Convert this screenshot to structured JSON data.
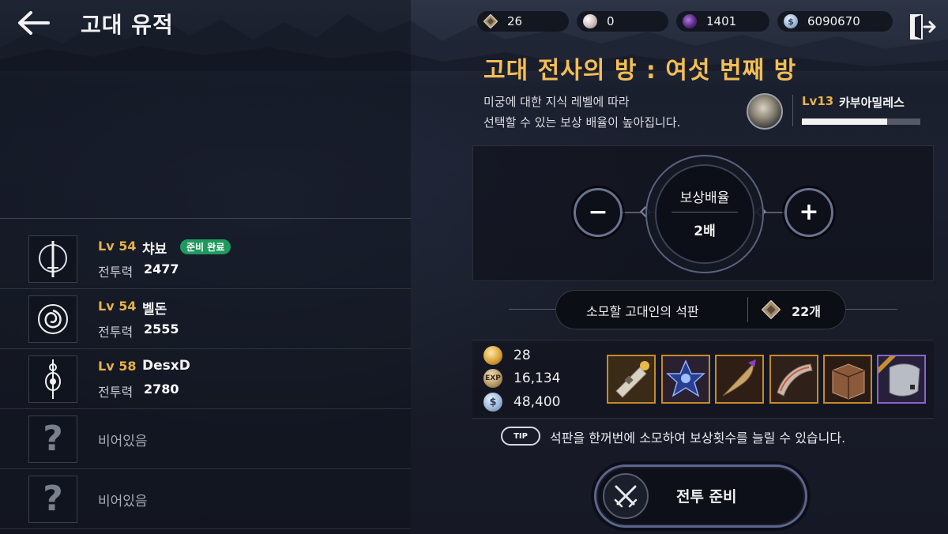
{
  "header": {
    "title": "고대 유적"
  },
  "currencies": [
    {
      "icon": "ancient-stone-icon",
      "value": "26"
    },
    {
      "icon": "pearl-icon",
      "value": "0"
    },
    {
      "icon": "dark-orb-icon",
      "value": "1401"
    },
    {
      "icon": "silver-coin-icon",
      "value": "6090670"
    }
  ],
  "party": {
    "members": [
      {
        "level": "Lv 54",
        "name": "챠뵤",
        "ready_badge": "준비 완료",
        "power_label": "전투력",
        "power": "2477",
        "icon": "sword-emblem-icon"
      },
      {
        "level": "Lv 54",
        "name": "벨돈",
        "power_label": "전투력",
        "power": "2555",
        "icon": "rose-emblem-icon"
      },
      {
        "level": "Lv 58",
        "name": "DesxD",
        "power_label": "전투력",
        "power": "2780",
        "icon": "staff-emblem-icon"
      }
    ],
    "empty_slots": [
      {
        "label": "비어있음"
      },
      {
        "label": "비어있음"
      }
    ]
  },
  "room": {
    "title": "고대 전사의 방 : 여섯 번째 방",
    "description_line1": "미궁에 대한 지식 레벨에 따라",
    "description_line2": "선택할 수 있는 보상 배율이 높아집니다."
  },
  "boss": {
    "level": "Lv13",
    "name": "카부아밀레스",
    "progress": 0.72
  },
  "multiplier": {
    "label": "보상배율",
    "value": "2배",
    "minus_symbol": "−",
    "plus_symbol": "+"
  },
  "consume": {
    "label": "소모할 고대인의 석판",
    "count": "22개"
  },
  "rewards": {
    "stats": [
      {
        "icon": "gold-medal-icon",
        "value": "28"
      },
      {
        "icon": "exp-icon",
        "icon_text": "EXP",
        "value": "16,134"
      },
      {
        "icon": "silver-coin-icon",
        "value": "48,400"
      }
    ],
    "items": [
      {
        "icon": "bandage-scroll-icon",
        "rarity": "orange"
      },
      {
        "icon": "blue-crystal-icon",
        "rarity": "orange"
      },
      {
        "icon": "feather-quill-icon",
        "rarity": "orange"
      },
      {
        "icon": "stone-tablet-icon",
        "rarity": "orange"
      },
      {
        "icon": "wooden-chest-icon",
        "rarity": "orange"
      },
      {
        "icon": "gray-cloth-icon",
        "rarity": "purple"
      }
    ]
  },
  "tip": {
    "badge": "TIP",
    "text": "석판을 한꺼번에 소모하여 보상횟수를 늘릴 수 있습니다."
  },
  "actions": {
    "battle_label": "전투 준비"
  },
  "colors": {
    "accent_gold": "#f4be55",
    "level_gold": "#e6b34a",
    "ready_green": "#1f9a5e",
    "item_orange": "#c58a2c",
    "item_purple": "#8a64c8"
  }
}
